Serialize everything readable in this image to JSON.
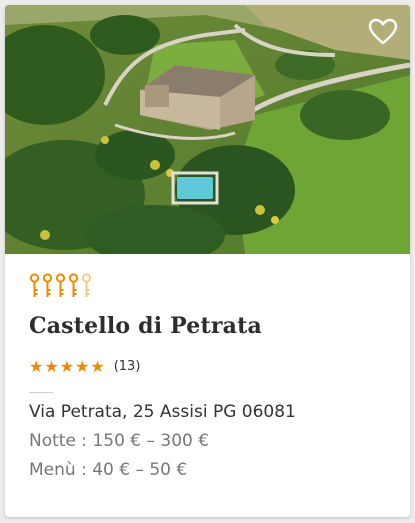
{
  "listing": {
    "photo_alt": "aerial-view-castle-pool",
    "favorite_icon": "heart-outline-icon",
    "keys": {
      "total": 5,
      "filled": 4,
      "icon": "key-icon",
      "color_filled": "#f08a00",
      "color_empty": "#f6c98a"
    },
    "title": "Castello di Petrata",
    "rating": {
      "stars_text": "★★★★★",
      "count_text": "(13)",
      "value": 5,
      "color": "#f08a00"
    },
    "address": "Via Petrata, 25 Assisi PG 06081",
    "night_price": "Notte : 150 € – 300 €",
    "menu_price": "Menù : 40 € – 50 €"
  }
}
